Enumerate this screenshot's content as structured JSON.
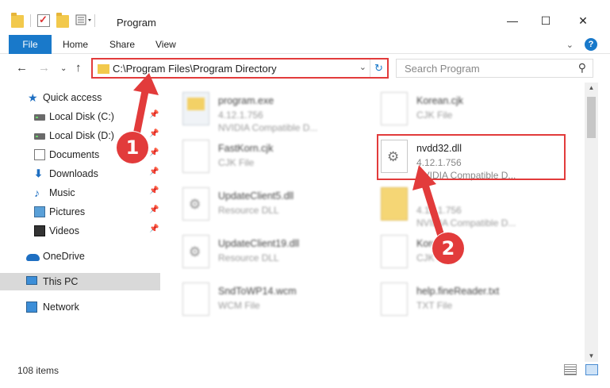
{
  "window": {
    "title": "Program",
    "controls": {
      "minimize": "—",
      "maximize": "☐",
      "close": "✕"
    }
  },
  "ribbon": {
    "tabs": [
      "File",
      "Home",
      "Share",
      "View"
    ]
  },
  "navbar": {
    "address": "C:\\Program Files\\Program Directory",
    "search_placeholder": "Search Program"
  },
  "sidebar": {
    "items": [
      {
        "label": "Quick access",
        "icon": "star-icon"
      },
      {
        "label": "Local Disk (C:)",
        "icon": "drive-icon",
        "pinned": true
      },
      {
        "label": "Local Disk (D:)",
        "icon": "drive-icon",
        "pinned": true
      },
      {
        "label": "Documents",
        "icon": "documents-icon",
        "pinned": true
      },
      {
        "label": "Downloads",
        "icon": "download-icon",
        "pinned": true
      },
      {
        "label": "Music",
        "icon": "music-icon",
        "pinned": true
      },
      {
        "label": "Pictures",
        "icon": "pictures-icon",
        "pinned": true
      },
      {
        "label": "Videos",
        "icon": "videos-icon",
        "pinned": true
      },
      {
        "label": "OneDrive",
        "icon": "cloud-icon"
      },
      {
        "label": "This PC",
        "icon": "computer-icon",
        "selected": true
      },
      {
        "label": "Network",
        "icon": "network-icon"
      }
    ]
  },
  "files": [
    {
      "name": "program.exe",
      "type": "4.12.1.756",
      "desc": "NVIDIA Compatible D...",
      "icon": "exe-icon"
    },
    {
      "name": "Korean.cjk",
      "type": "CJK File",
      "icon": "file-icon"
    },
    {
      "name": "FastKorn.cjk",
      "type": "CJK File",
      "icon": "file-icon"
    },
    {
      "name": "nvdd32.dll",
      "type": "4.12.1.756",
      "desc": "NVIDIA Compatible D...",
      "icon": "dll-icon"
    },
    {
      "name": "UpdateClient5.dll",
      "type": "Resource DLL",
      "icon": "dll-icon"
    },
    {
      "name": "",
      "type": "4.12.1.756",
      "desc": "NVIDIA Compatible D...",
      "icon": "folder-icon"
    },
    {
      "name": "UpdateClient19.dll",
      "type": "Resource DLL",
      "icon": "dll-icon"
    },
    {
      "name": "Kore...",
      "type": "CJK File",
      "icon": "file-icon"
    },
    {
      "name": "SndToWP14.wcm",
      "type": "WCM File",
      "icon": "file-icon"
    },
    {
      "name": "help.fineReader.txt",
      "type": "TXT File",
      "icon": "file-icon"
    }
  ],
  "status": {
    "item_count": "108 items"
  },
  "callouts": [
    "1",
    "2"
  ],
  "colors": {
    "accent": "#1979ca",
    "highlight": "#e23b3b",
    "selected_bg": "#d9d9d9"
  }
}
